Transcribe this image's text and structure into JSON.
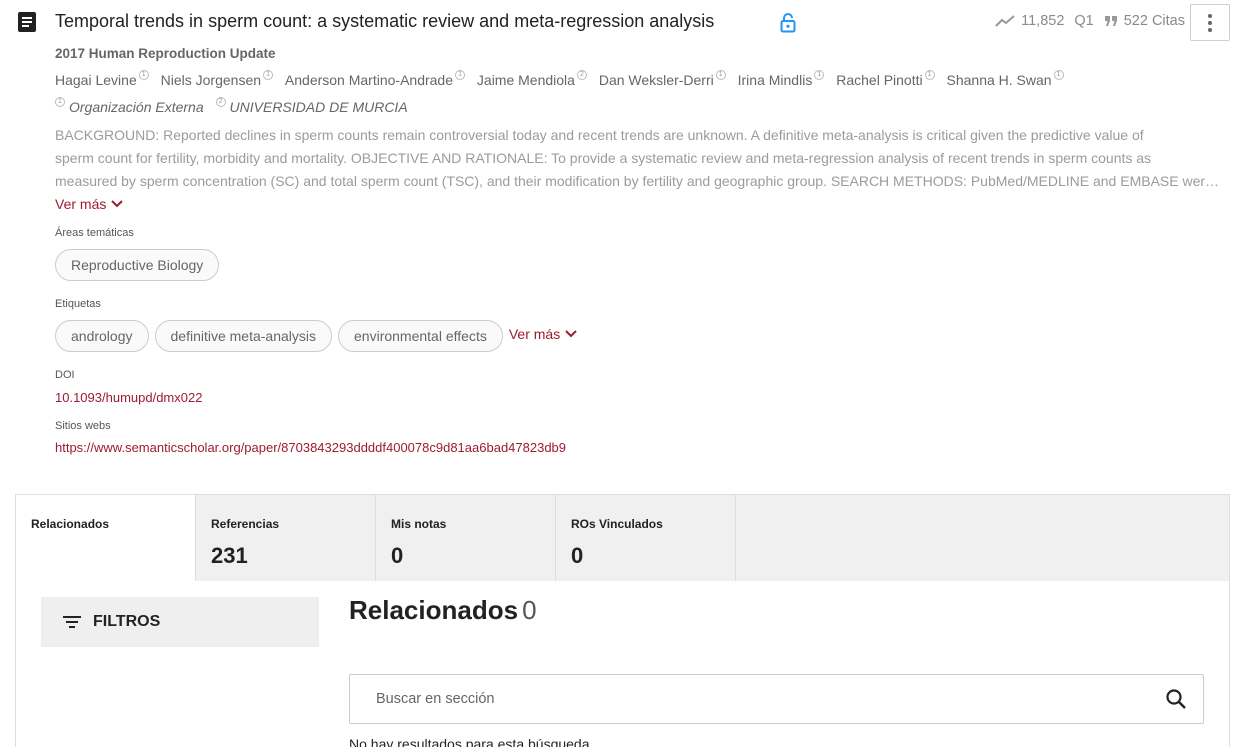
{
  "header": {
    "title": "Temporal trends in sperm count: a systematic review and meta-regression analysis",
    "views": "11,852",
    "quartile": "Q1",
    "citations": "522 Citas"
  },
  "journal": "2017 Human Reproduction Update",
  "authors": [
    {
      "name": "Hagai Levine",
      "badge": "1"
    },
    {
      "name": "Niels Jorgensen",
      "badge": "1"
    },
    {
      "name": "Anderson Martino-Andrade",
      "badge": "1"
    },
    {
      "name": "Jaime Mendiola",
      "badge": "2"
    },
    {
      "name": "Dan Weksler-Derri",
      "badge": "1"
    },
    {
      "name": "Irina Mindlis",
      "badge": "1"
    },
    {
      "name": "Rachel Pinotti",
      "badge": "1"
    },
    {
      "name": "Shanna H. Swan",
      "badge": "1"
    }
  ],
  "affiliations": [
    {
      "badge": "1",
      "name": "Organización Externa"
    },
    {
      "badge": "2",
      "name": "UNIVERSIDAD DE MURCIA"
    }
  ],
  "abstract": {
    "line1": "BACKGROUND: Reported declines in sperm counts remain controversial today and recent trends are unknown. A definitive meta-analysis is critical given the predictive value of",
    "line2": "sperm count for fertility, morbidity and mortality. OBJECTIVE AND RATIONALE: To provide a systematic review and meta-regression analysis of recent trends in sperm counts as",
    "line3": "measured by sperm concentration (SC) and total sperm count (TSC), and their modification by fertility and geographic group. SEARCH METHODS: PubMed/MEDLINE and EMBASE were searched",
    "more": "Ver más"
  },
  "areas": {
    "label": "Áreas temáticas",
    "items": [
      "Reproductive Biology"
    ]
  },
  "tags": {
    "label": "Etiquetas",
    "items": [
      "andrology",
      "definitive meta-analysis",
      "environmental effects"
    ],
    "more": "Ver más"
  },
  "doi": {
    "label": "DOI",
    "value": "10.1093/humupd/dmx022"
  },
  "websites": {
    "label": "Sitios webs",
    "value": "https://www.semanticscholar.org/paper/8703843293ddddf400078c9d81aa6bad47823db9"
  },
  "tabs": [
    {
      "label": "Relacionados",
      "count": ""
    },
    {
      "label": "Referencias",
      "count": "231"
    },
    {
      "label": "Mis notas",
      "count": "0"
    },
    {
      "label": "ROs Vinculados",
      "count": "0"
    }
  ],
  "filters": {
    "label": "FILTROS"
  },
  "section": {
    "title": "Relacionados",
    "count": "0"
  },
  "search": {
    "placeholder": "Buscar en sección"
  },
  "noresults": "No hay resultados para esta búsqueda",
  "colors": {
    "accent": "#9e1b32",
    "lock": "#2196f3"
  },
  "icons": [
    "document-icon",
    "lock-icon",
    "trending-icon",
    "quote-icon",
    "more-vert-icon",
    "chevron-down-icon",
    "filter-icon",
    "search-icon"
  ]
}
